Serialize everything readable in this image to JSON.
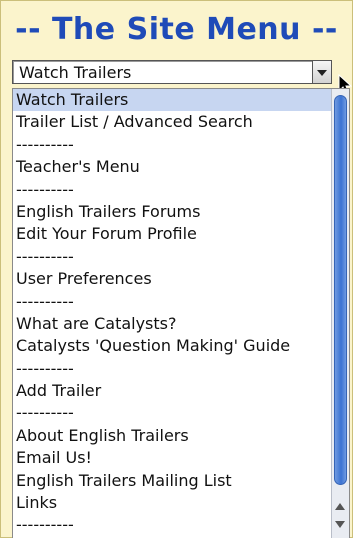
{
  "menu": {
    "title": "-- The Site Menu --",
    "selected_value": "Watch Trailers",
    "options": [
      "Watch Trailers",
      "Trailer List / Advanced Search",
      "----------",
      "Teacher's Menu",
      "----------",
      "English Trailers Forums",
      "Edit Your Forum Profile",
      "----------",
      "User Preferences",
      "----------",
      "What are Catalysts?",
      "Catalysts 'Question Making' Guide",
      "----------",
      "Add Trailer",
      "----------",
      "About English Trailers",
      "Email Us!",
      "English Trailers Mailing List",
      "Links",
      "----------"
    ],
    "selected_index": 0
  },
  "colors": {
    "background": "#fbf4cc",
    "title": "#1f4bb8",
    "highlight": "#c7d6f1",
    "scroll_thumb": "#3b73d3"
  },
  "icons": {
    "dropdown_arrow": "chevron-down-icon",
    "cursor": "mouse-pointer-icon",
    "scroll_up": "scroll-up-arrow-icon",
    "scroll_down": "scroll-down-arrow-icon"
  }
}
